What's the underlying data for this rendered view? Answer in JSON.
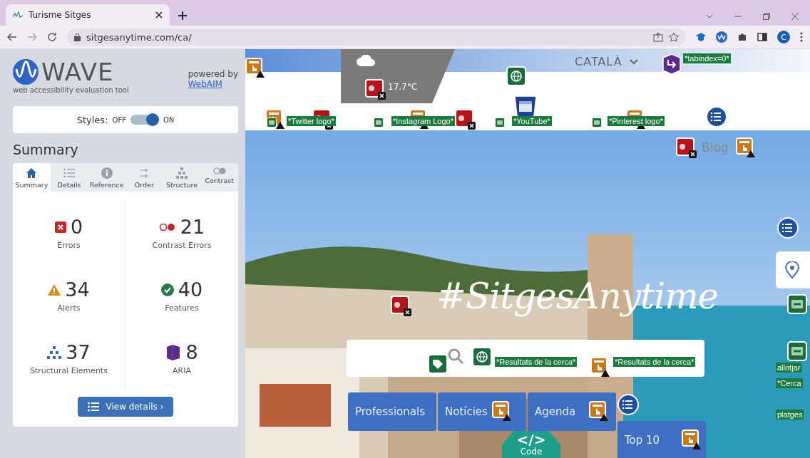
{
  "browser": {
    "tab_title": "Turisme Sitges",
    "url": "sitgesanytime.com/ca/",
    "profile_initial": "C"
  },
  "wave": {
    "logo": "WAVE",
    "tagline": "web accessibility evaluation tool",
    "powered_by": "powered by",
    "link": "WebAIM",
    "styles": {
      "label": "Styles:",
      "off_label": "OFF",
      "on_label": "ON",
      "on": true
    },
    "heading": "Summary",
    "tabs": [
      {
        "label": "Summary",
        "kind": "home",
        "selected": true
      },
      {
        "label": "Details",
        "kind": "list",
        "selected": false
      },
      {
        "label": "Reference",
        "kind": "info",
        "selected": false
      },
      {
        "label": "Order",
        "kind": "order",
        "selected": false
      },
      {
        "label": "Structure",
        "kind": "tree",
        "selected": false
      },
      {
        "label": "Contrast",
        "kind": "contrast",
        "selected": false
      }
    ],
    "stats": [
      {
        "kind": "error",
        "count": "0",
        "label": "Errors"
      },
      {
        "kind": "contrast",
        "count": "21",
        "label": "Contrast Errors"
      },
      {
        "kind": "alert",
        "count": "34",
        "label": "Alerts"
      },
      {
        "kind": "feature",
        "count": "40",
        "label": "Features"
      },
      {
        "kind": "structure",
        "count": "37",
        "label": "Structural Elements"
      },
      {
        "kind": "aria",
        "count": "8",
        "label": "ARIA"
      }
    ],
    "button": "View details ›"
  },
  "site": {
    "language": "CATALÀ",
    "temperature": "17.7°C",
    "blog": "Blog",
    "hashtag": "#SitgesAnytime",
    "tags": [
      "*tabindex=0*",
      "*Twitter logo*",
      "*Instagram Logo*",
      "*YouTube*",
      "*Pinterest logo*",
      "*Resultats de la cerca*",
      "*Resultats de la cerca*",
      "allotjar",
      "*Cerca",
      "platges"
    ],
    "nav": [
      "Professionals",
      "Notícies",
      "Agenda",
      "Top 10"
    ],
    "code_button": {
      "symbol": "</>",
      "label": "Code"
    }
  }
}
